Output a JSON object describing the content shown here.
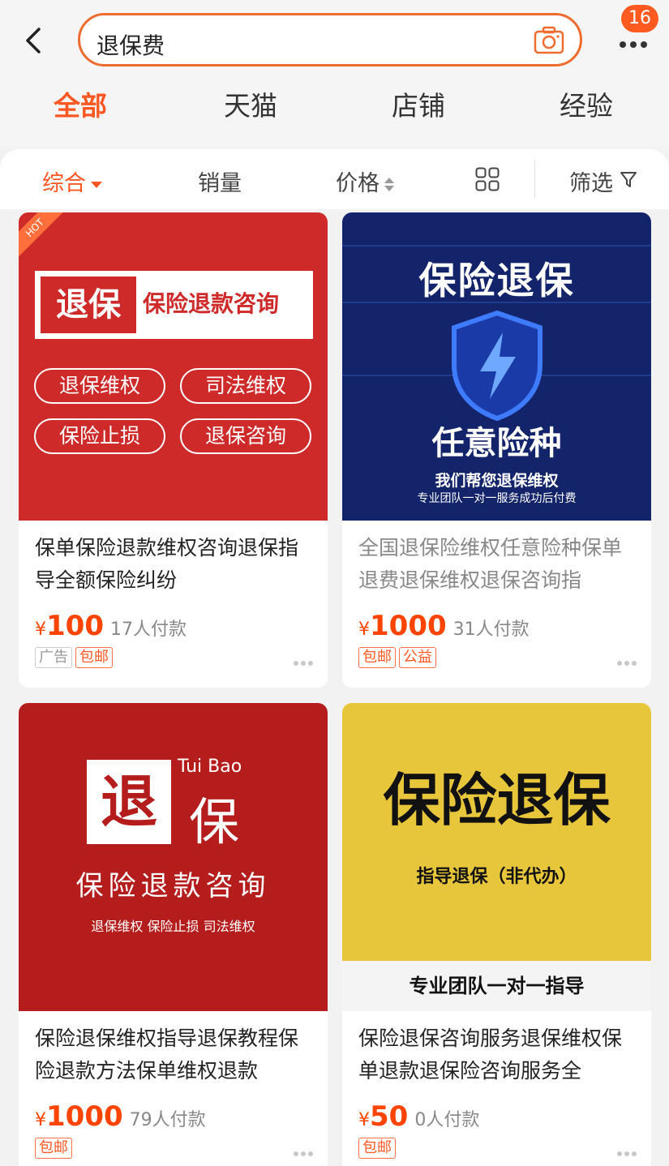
{
  "header": {
    "search_query": "退保费",
    "badge_count": "16"
  },
  "tabs": [
    {
      "label": "全部",
      "active": true
    },
    {
      "label": "天猫",
      "active": false
    },
    {
      "label": "店铺",
      "active": false
    },
    {
      "label": "经验",
      "active": false
    }
  ],
  "sortbar": {
    "comprehensive": "综合",
    "sales": "销量",
    "price": "价格",
    "filter": "筛选"
  },
  "colors": {
    "accent": "#ff5722",
    "price": "#ff4400"
  },
  "products": [
    {
      "title": "保单保险退款维权咨询退保指导全额保险纠纷",
      "yen": "¥",
      "price": "100",
      "sold": "17人付款",
      "tags": [
        "广告",
        "包邮"
      ],
      "image": {
        "hot": "HOT",
        "banner_left": "退保",
        "banner_right": "保险退款咨询",
        "pills": [
          "退保维权",
          "司法维权",
          "保险止损",
          "退保咨询"
        ]
      }
    },
    {
      "title": "全国退保险维权任意险种保单退费退保维权退保咨询指",
      "yen": "¥",
      "price": "1000",
      "sold": "31人付款",
      "tags": [
        "包邮",
        "公益"
      ],
      "image": {
        "headline": "保险退保",
        "sub": "任意险种",
        "line1": "我们帮您退保维权",
        "line2": "专业团队一对一服务成功后付费"
      }
    },
    {
      "title": "保险退保维权指导退保教程保险退款方法保单维权退款",
      "yen": "¥",
      "price": "1000",
      "sold": "79人付款",
      "tags": [
        "包邮"
      ],
      "image": {
        "box": "退",
        "en": "Tui Bao",
        "big": "保",
        "mid": "保险退款咨询",
        "small": "退保维权  保险止损  司法维权"
      }
    },
    {
      "title": "保险退保咨询服务退保维权保单退款退保险咨询服务全",
      "yen": "¥",
      "price": "50",
      "sold": "0人付款",
      "tags": [
        "包邮"
      ],
      "image": {
        "big": "保险退保",
        "mid": "指导退保（非代办）",
        "bottom": "专业团队一对一指导"
      }
    }
  ]
}
